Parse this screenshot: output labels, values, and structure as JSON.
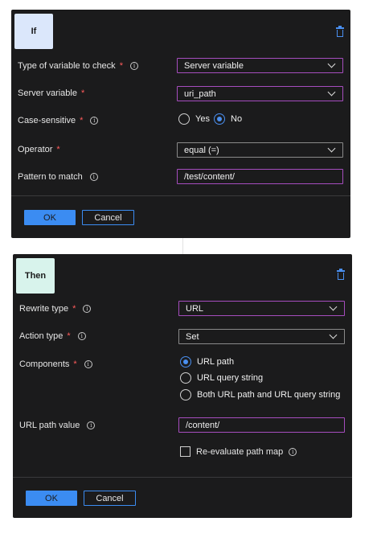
{
  "if_panel": {
    "badge": "If",
    "fields": {
      "variable_type": {
        "label": "Type of variable to check",
        "value": "Server variable"
      },
      "server_variable": {
        "label": "Server variable",
        "value": "uri_path"
      },
      "case_sensitive": {
        "label": "Case-sensitive",
        "options": [
          "Yes",
          "No"
        ],
        "selected": "No"
      },
      "operator": {
        "label": "Operator",
        "value": "equal (=)"
      },
      "pattern": {
        "label": "Pattern to match",
        "value": "/test/content/"
      }
    },
    "ok_label": "OK",
    "cancel_label": "Cancel"
  },
  "then_panel": {
    "badge": "Then",
    "fields": {
      "rewrite_type": {
        "label": "Rewrite type",
        "value": "URL"
      },
      "action_type": {
        "label": "Action type",
        "value": "Set"
      },
      "components": {
        "label": "Components",
        "options": [
          "URL path",
          "URL query string",
          "Both URL path and URL query string"
        ],
        "selected": "URL path"
      },
      "url_path_value": {
        "label": "URL path value",
        "value": "/content/"
      },
      "reevaluate": {
        "label": "Re-evaluate path map",
        "checked": false
      }
    },
    "ok_label": "OK",
    "cancel_label": "Cancel"
  },
  "required_marker": "*",
  "colors": {
    "accent": "#3b8cf2",
    "focus_border": "#a64dbe",
    "required": "#ff5b5b",
    "panel_bg": "#1b1b1c"
  }
}
